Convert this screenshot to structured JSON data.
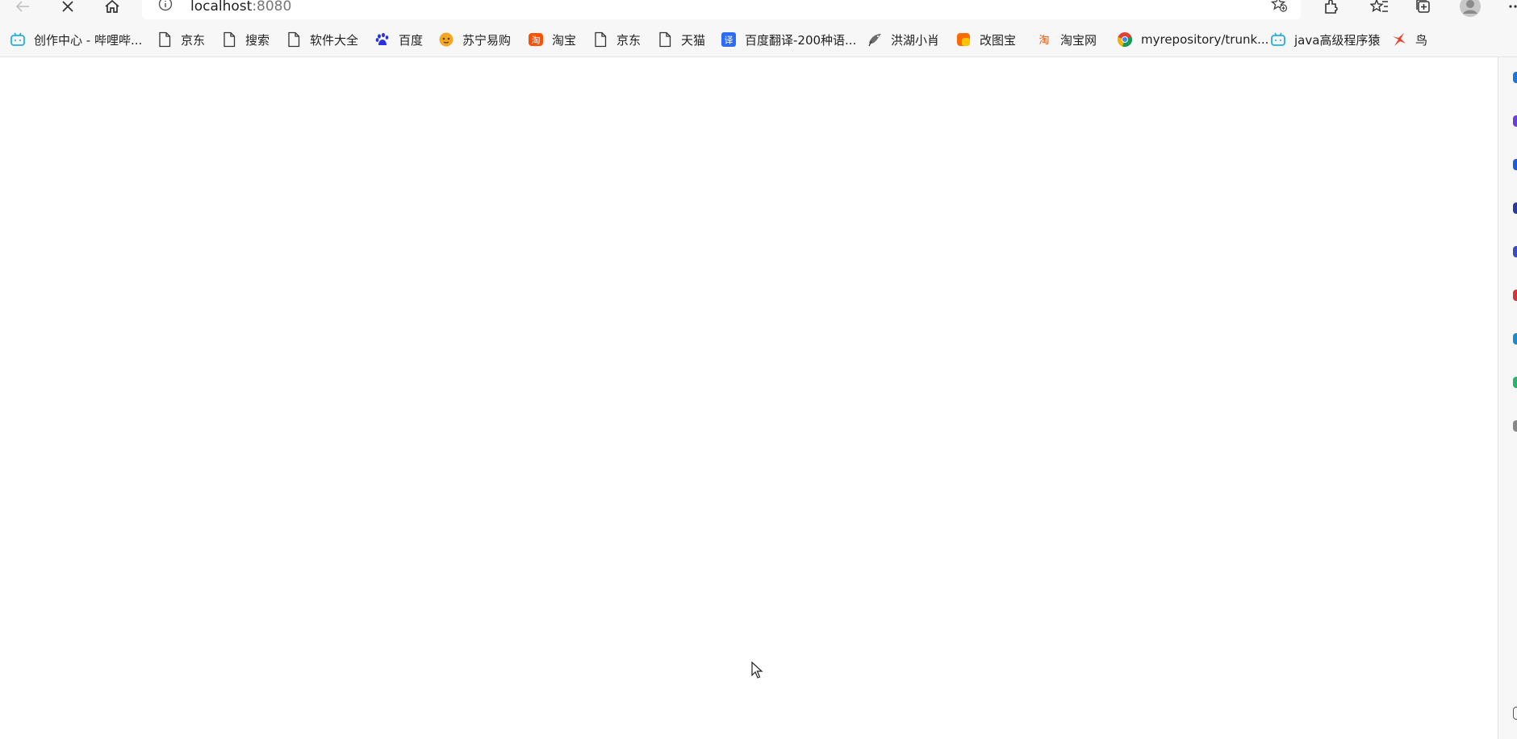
{
  "address": {
    "host": "localhost",
    "port": ":8080"
  },
  "bookmarks": [
    {
      "label": "创作中心 - 哔哩哔...",
      "icon": "bilibili-icon"
    },
    {
      "label": "京东",
      "icon": "page-icon"
    },
    {
      "label": "搜索",
      "icon": "page-icon"
    },
    {
      "label": "软件大全",
      "icon": "page-icon"
    },
    {
      "label": "百度",
      "icon": "baidu-paw-icon"
    },
    {
      "label": "苏宁易购",
      "icon": "suning-icon"
    },
    {
      "label": "淘宝",
      "icon": "taobao-icon"
    },
    {
      "label": "京东",
      "icon": "page-icon"
    },
    {
      "label": "天猫",
      "icon": "page-icon"
    },
    {
      "label": "百度翻译-200种语...",
      "icon": "translate-icon"
    },
    {
      "label": "洪湖小肖",
      "icon": "bird-icon"
    },
    {
      "label": "改图宝",
      "icon": "gaitubao-icon"
    },
    {
      "label": "淘宝网",
      "icon": "taobao-icon"
    },
    {
      "label": "myrepository/trunk...",
      "icon": "chrome-icon"
    },
    {
      "label": "java高级程序猿",
      "icon": "bilibili-icon"
    },
    {
      "label": "鸟",
      "icon": "red-bird-icon"
    }
  ],
  "colors": {
    "bilibili": "#23ade5",
    "baidu": "#2932e1",
    "suning": "#f5a623",
    "taobao": "#ff5000",
    "translate": "#2c6cf6",
    "gaitubao": "#ff6a00"
  }
}
